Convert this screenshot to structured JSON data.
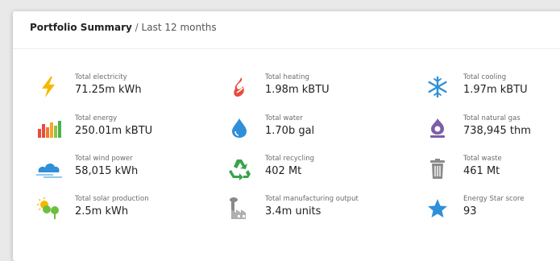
{
  "header": {
    "title": "Portfolio Summary",
    "separator": "/",
    "subtitle": "Last 12 months"
  },
  "metrics": [
    {
      "label": "Total electricity",
      "value": "71.25m kWh",
      "icon": "lightning-icon",
      "color": "#f5b800"
    },
    {
      "label": "Total heating",
      "value": "1.98m kBTU",
      "icon": "flame-icon",
      "color": "#e94b3c"
    },
    {
      "label": "Total cooling",
      "value": "1.97m kBTU",
      "icon": "snowflake-icon",
      "color": "#2f8fd8"
    },
    {
      "label": "Total energy",
      "value": "250.01m kBTU",
      "icon": "energy-bars-icon",
      "color": "#e55a3b"
    },
    {
      "label": "Total water",
      "value": "1.70b gal",
      "icon": "water-drop-icon",
      "color": "#2f8fd8"
    },
    {
      "label": "Total natural gas",
      "value": "738,945 thm",
      "icon": "gas-flame-icon",
      "color": "#7b5ea7"
    },
    {
      "label": "Total wind power",
      "value": "58,015 kWh",
      "icon": "wind-cloud-icon",
      "color": "#2f8fd8"
    },
    {
      "label": "Total recycling",
      "value": "402 Mt",
      "icon": "recycle-icon",
      "color": "#3aa34a"
    },
    {
      "label": "Total waste",
      "value": "461 Mt",
      "icon": "trash-icon",
      "color": "#8a8a8a"
    },
    {
      "label": "Total solar production",
      "value": "2.5m kWh",
      "icon": "solar-plant-icon",
      "color": "#6cbf3b"
    },
    {
      "label": "Total manufacturing output",
      "value": "3.4m units",
      "icon": "factory-icon",
      "color": "#8a8a8a"
    },
    {
      "label": "Energy Star score",
      "value": "93",
      "icon": "star-icon",
      "color": "#2f8fd8"
    }
  ]
}
